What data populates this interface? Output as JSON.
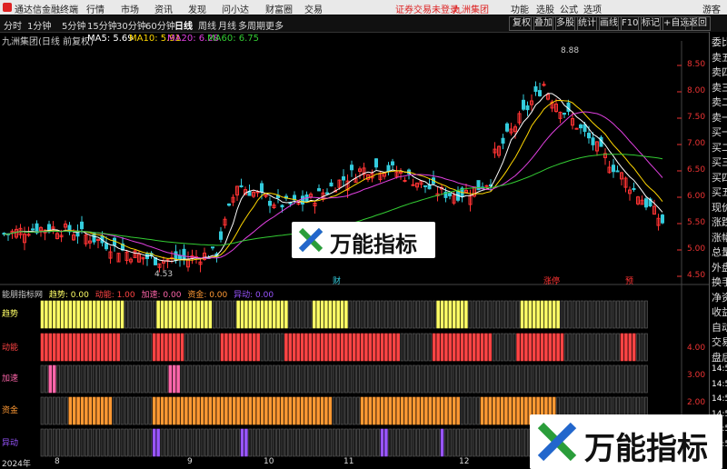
{
  "topbar": {
    "app_title": "通达信金融终端",
    "menu": [
      "行情",
      "市场",
      "资讯",
      "发现",
      "问小达",
      "财富圈",
      "交易"
    ],
    "alert": "证券交易未登录",
    "stock": "九洲集团",
    "right_menu": [
      "功能",
      "选股",
      "公式",
      "选项"
    ],
    "guest": "游客"
  },
  "toolbar": {
    "periods": [
      "分时",
      "1分钟",
      "5分钟",
      "15分钟",
      "30分钟",
      "60分钟",
      "日线",
      "周线",
      "月线",
      "多周期",
      "更多"
    ],
    "active_period": "日线",
    "buttons": [
      "复权",
      "叠加",
      "多股",
      "统计",
      "画线",
      "F10",
      "标记",
      "+自选",
      "返回"
    ]
  },
  "chart": {
    "title": "九洲集团(日线 前复权)",
    "ma5": "MA5: 5.69",
    "ma10": "MA10: 5.91",
    "ma20": "MA20: 6.28",
    "ma60": "MA60: 6.75",
    "high_label": "8.88",
    "low_label": "4.53",
    "y_ticks": [
      "8.50",
      "8.00",
      "7.50",
      "7.00",
      "6.50",
      "6.00",
      "5.50",
      "5.00",
      "4.50"
    ],
    "events": [
      "财",
      "涨停",
      "预"
    ],
    "colors": {
      "ma5": "#ffffff",
      "ma10": "#ffd700",
      "ma20": "#e040e0",
      "ma60": "#33cc33",
      "up": "#ff3333",
      "down": "#33ccdd"
    }
  },
  "indicator": {
    "name": "能朋指标网",
    "values": [
      {
        "label": "趋势: 0.00",
        "color": "#ffff66"
      },
      {
        "label": "动能: 1.00",
        "color": "#ff4444"
      },
      {
        "label": "加速: 0.00",
        "color": "#ff66aa"
      },
      {
        "label": "资金: 0.00",
        "color": "#ff9933"
      },
      {
        "label": "异动: 0.00",
        "color": "#9955ff"
      }
    ],
    "rows": [
      {
        "label": "趋势",
        "color": "#ffff66"
      },
      {
        "label": "动能",
        "color": "#ff4444"
      },
      {
        "label": "加速",
        "color": "#ff66aa"
      },
      {
        "label": "资金",
        "color": "#ff9933"
      },
      {
        "label": "异动",
        "color": "#9955ff"
      }
    ],
    "y_ticks": [
      "4.00",
      "3.00",
      "2.00"
    ]
  },
  "dates": [
    "2024年",
    "8",
    "9",
    "10",
    "11",
    "12"
  ],
  "right_panel": [
    "委比",
    "卖五",
    "卖四",
    "卖三",
    "卖二",
    "卖一",
    "买一",
    "买二",
    "买三",
    "买四",
    "买五",
    "现价",
    "涨跌",
    "涨幅",
    "总量",
    "外盘",
    "换手",
    "净资",
    "收益",
    "自动",
    "交易",
    "盘后",
    "14:56",
    "14:56",
    "14:56",
    "14:56",
    "14:56",
    "14:56"
  ],
  "watermark": "万能指标"
}
